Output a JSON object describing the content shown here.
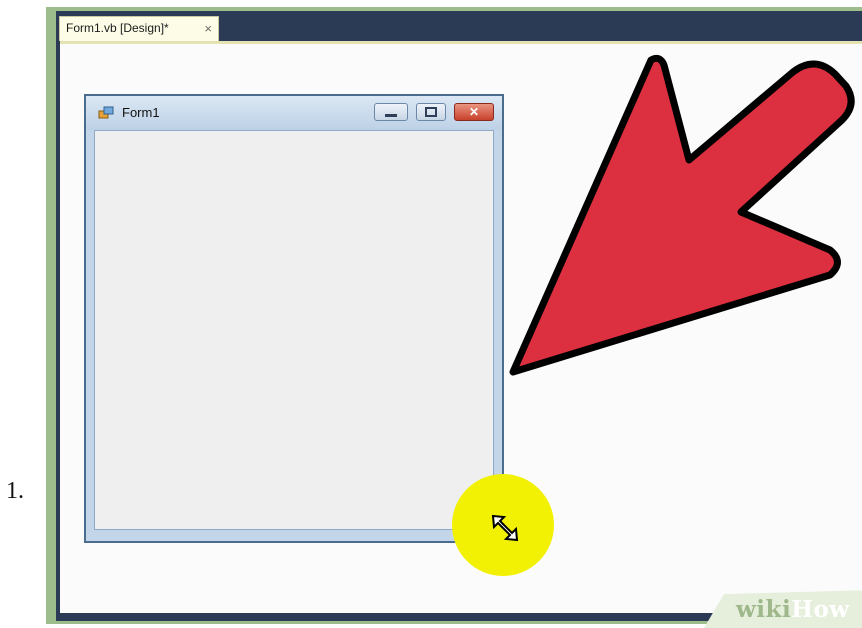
{
  "step": {
    "number": "1."
  },
  "editor": {
    "tab_label": "Form1.vb [Design]*",
    "tab_close_glyph": "×"
  },
  "form": {
    "title": "Form1",
    "icon": "form-app-icon",
    "close_glyph": "✕"
  },
  "annotation": {
    "arrow_icon": "pointer-arrow-icon",
    "arrow_color": "#dc2f3f",
    "highlight_color": "#f2f103",
    "cursor_icon": "diagonal-resize-cursor-icon"
  },
  "watermark": {
    "part1": "wiki",
    "part2": "How"
  },
  "colors": {
    "frame_green": "#9dbd8c",
    "ide_dark": "#2b3b55",
    "tab_background": "#fdfde7",
    "form_border": "#4a6d8e",
    "form_client": "#efeff0"
  }
}
